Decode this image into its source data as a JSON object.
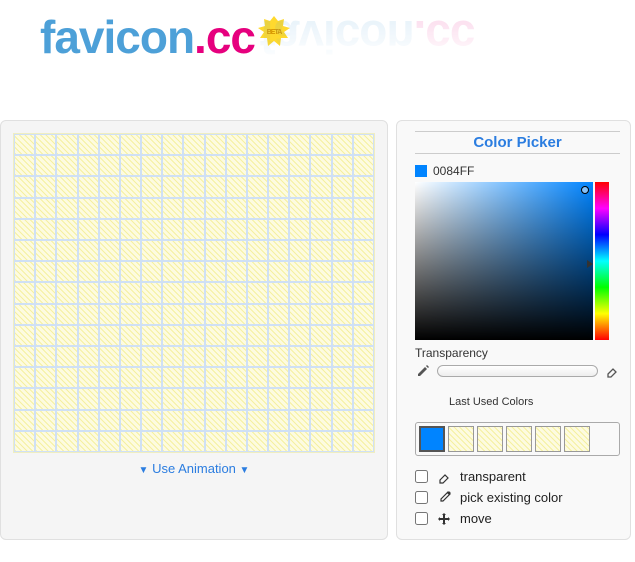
{
  "logo": {
    "part1": "favicon",
    "dot": ".",
    "part2": "cc",
    "badge": "BETA"
  },
  "animation_toggle": "Use Animation",
  "picker": {
    "title": "Color Picker",
    "current_hex": "0084FF",
    "transparency_label": "Transparency"
  },
  "last_colors": {
    "title": "Last Used Colors",
    "swatches": [
      "#0084FF",
      "pattern",
      "pattern",
      "pattern",
      "pattern",
      "pattern"
    ]
  },
  "options": {
    "transparent": "transparent",
    "pick": "pick existing color",
    "move": "move"
  }
}
